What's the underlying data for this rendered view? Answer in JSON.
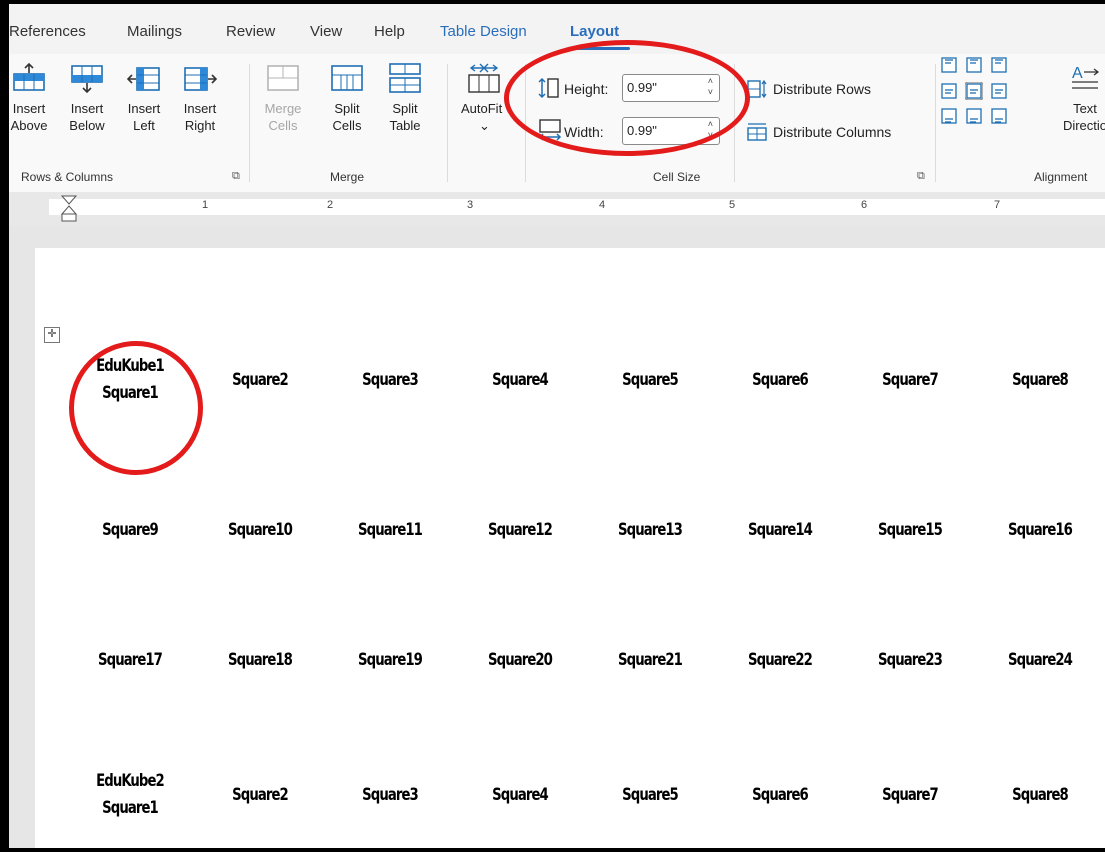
{
  "tabs": [
    "References",
    "Mailings",
    "Review",
    "View",
    "Help",
    "Table Design",
    "Layout"
  ],
  "ribbon": {
    "rows_columns": {
      "insert_above": [
        "Insert",
        "Above"
      ],
      "insert_below": [
        "Insert",
        "Below"
      ],
      "insert_left": [
        "Insert",
        "Left"
      ],
      "insert_right": [
        "Insert",
        "Right"
      ],
      "group_label": "Rows & Columns"
    },
    "merge": {
      "merge_cells": [
        "Merge",
        "Cells"
      ],
      "split_cells": [
        "Split",
        "Cells"
      ],
      "split_table": [
        "Split",
        "Table"
      ],
      "group_label": "Merge"
    },
    "autofit": {
      "label": "AutoFit",
      "chevron": "⌄"
    },
    "cell_size": {
      "height_label": "Height:",
      "height_value": "0.99\"",
      "width_label": "Width:",
      "width_value": "0.99\"",
      "distribute_rows": "Distribute Rows",
      "distribute_columns": "Distribute Columns",
      "group_label": "Cell Size"
    },
    "alignment": {
      "text_direction": [
        "Text",
        "Directio"
      ],
      "group_label": "Alignment"
    }
  },
  "ruler": {
    "numbers": [
      "1",
      "2",
      "3",
      "4",
      "5",
      "6",
      "7"
    ]
  },
  "table": {
    "rows": [
      [
        [
          "EduKube1",
          "Square1"
        ],
        [
          "Square2"
        ],
        [
          "Square3"
        ],
        [
          "Square4"
        ],
        [
          "Square5"
        ],
        [
          "Square6"
        ],
        [
          "Square7"
        ],
        [
          "Square8"
        ]
      ],
      [
        [
          "Square9"
        ],
        [
          "Square10"
        ],
        [
          "Square11"
        ],
        [
          "Square12"
        ],
        [
          "Square13"
        ],
        [
          "Square14"
        ],
        [
          "Square15"
        ],
        [
          "Square16"
        ]
      ],
      [
        [
          "Square17"
        ],
        [
          "Square18"
        ],
        [
          "Square19"
        ],
        [
          "Square20"
        ],
        [
          "Square21"
        ],
        [
          "Square22"
        ],
        [
          "Square23"
        ],
        [
          "Square24"
        ]
      ],
      [
        [
          "EduKube2",
          "Square1"
        ],
        [
          "Square2"
        ],
        [
          "Square3"
        ],
        [
          "Square4"
        ],
        [
          "Square5"
        ],
        [
          "Square6"
        ],
        [
          "Square7"
        ],
        [
          "Square8"
        ]
      ]
    ]
  },
  "colors": {
    "accent": "#2a6ebb",
    "highlight_ring": "#e31b1b"
  }
}
